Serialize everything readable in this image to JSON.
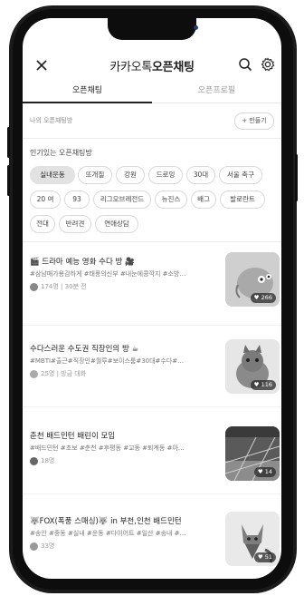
{
  "header": {
    "title_part1": "카카오톡",
    "title_part2": "오픈채팅",
    "close_icon": "close-icon",
    "search_icon": "search-icon",
    "settings_icon": "gear-icon"
  },
  "tabs": [
    {
      "label": "오픈채팅",
      "active": true
    },
    {
      "label": "오픈프로필",
      "active": false
    }
  ],
  "my_rooms": {
    "label": "나의 오픈채팅방",
    "create_label": "+ 만들기"
  },
  "popular": {
    "label": "인기있는 오픈채팅방",
    "chips": [
      "실내운동",
      "또개질",
      "강원",
      "드로잉",
      "30대",
      "서울 축구",
      "20 여",
      "93",
      "리그오브레전드",
      "뉴진스",
      "배그",
      "발로란트",
      "전대",
      "반려견",
      "연애상담"
    ]
  },
  "rooms": [
    {
      "title": "🎬 드라마 예능 영화 수다 방 🎥",
      "tags": "#삼남매가용감하게 #태풍의신부 #내눈에콩깍지 #소방…",
      "meta": "174명 | 30분 전",
      "likes": "266"
    },
    {
      "title": "수다스러운 수도권 직장인의 방 ☕",
      "tags": "#MBTI#출근#직장인#월루#보이스룸#30대#수다#…",
      "meta": "25명 | 방금 대화",
      "likes": "116"
    },
    {
      "title": "춘천 배드민턴 배린이 모임",
      "tags": "#배드민턴 #초보 #춘천 #후평동 #교동 #퇴계동 #아…",
      "meta": "18명",
      "likes": "14"
    },
    {
      "title": "🐺FOX(폭풍 스매싱)🐺 in 부천,인천 배드민턴",
      "tags": "#송안 #중동 #실내 #운동 #다이어트 #일산 #송내 #…",
      "meta": "33명",
      "likes": "51"
    }
  ]
}
